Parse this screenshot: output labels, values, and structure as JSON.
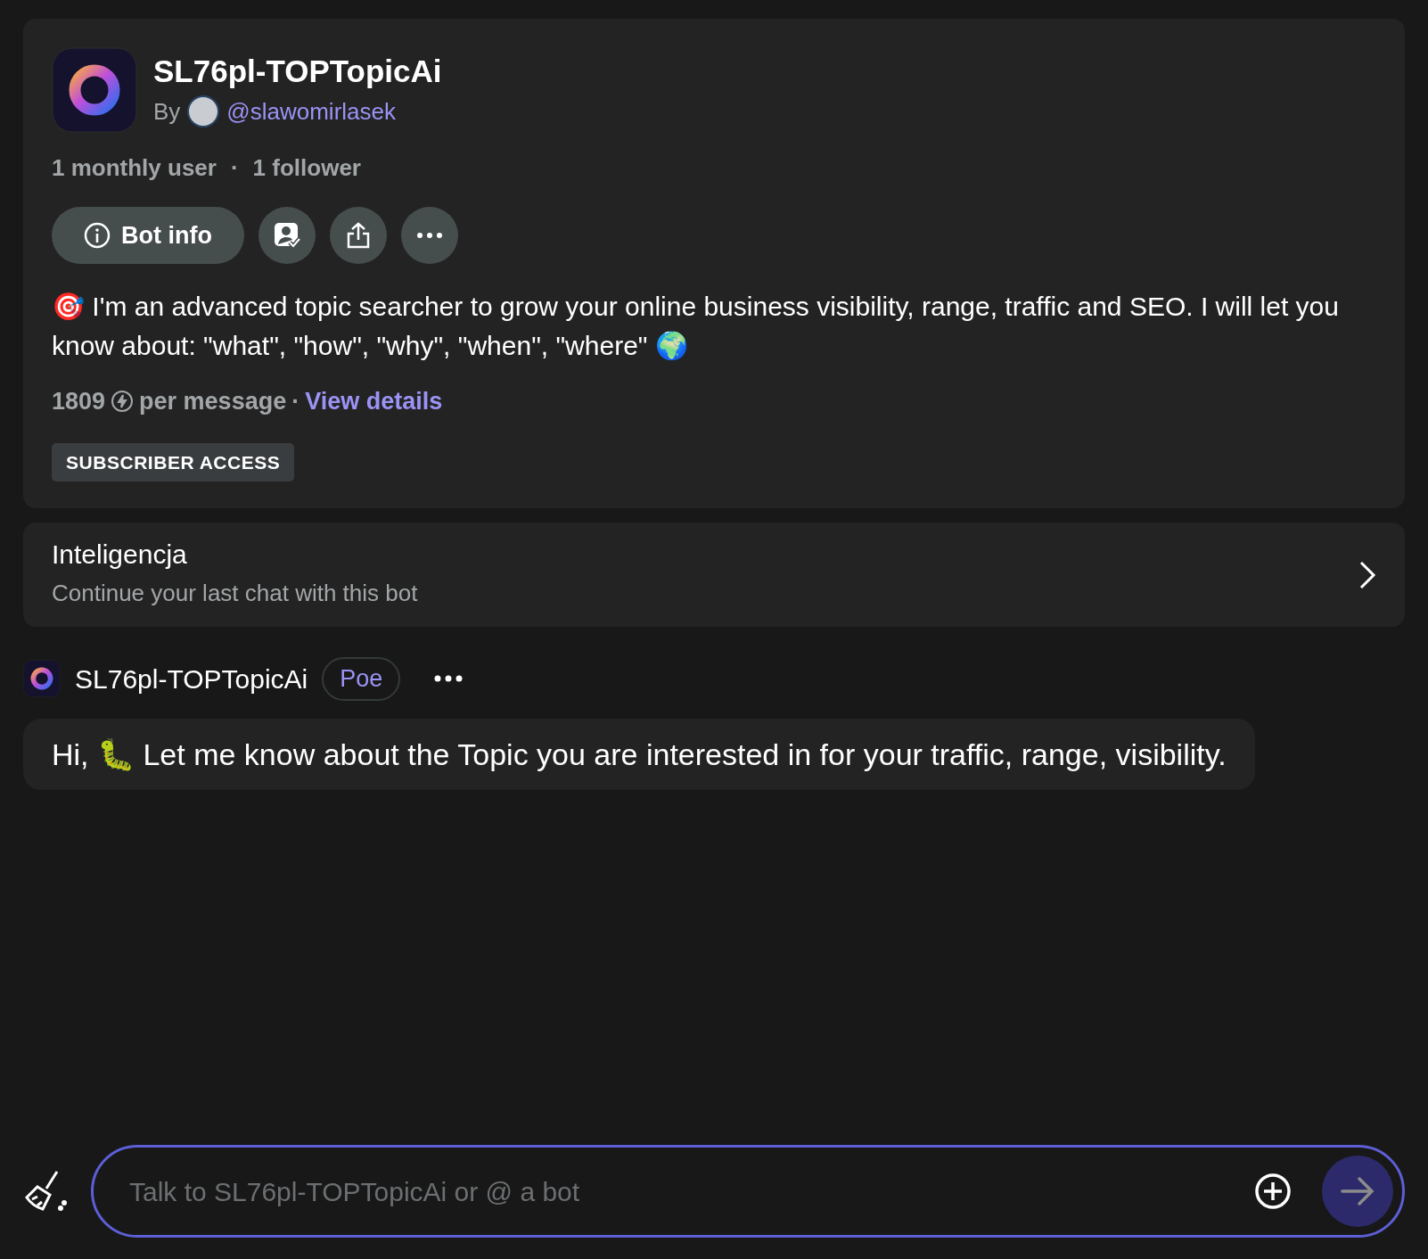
{
  "bot": {
    "name": "SL76pl-TOPTopicAi",
    "by_label": "By",
    "author": "@slawomirlasek",
    "stats": [
      "1 monthly user",
      "1 follower"
    ],
    "stats_separator": "·",
    "bot_info_button": "Bot info",
    "description": "🎯 I'm an advanced topic searcher to grow your online business visibility, range, traffic and SEO. I will let you know about: \"what\", \"how\", \"why\", \"when\", \"where\" 🌍",
    "price": "1809",
    "price_suffix": "per message",
    "price_separator": "·",
    "view_details": "View details",
    "access_badge": "SUBSCRIBER ACCESS"
  },
  "last_chat": {
    "title": "Inteligencja",
    "subtitle": "Continue your last chat with this bot"
  },
  "message": {
    "sender": "SL76pl-TOPTopicAi",
    "badge": "Poe",
    "text": "Hi, 🐛 Let me know about the Topic you are interested in for your traffic, range, visibility."
  },
  "composer": {
    "placeholder": "Talk to SL76pl-TOPTopicAi or @ a bot"
  }
}
